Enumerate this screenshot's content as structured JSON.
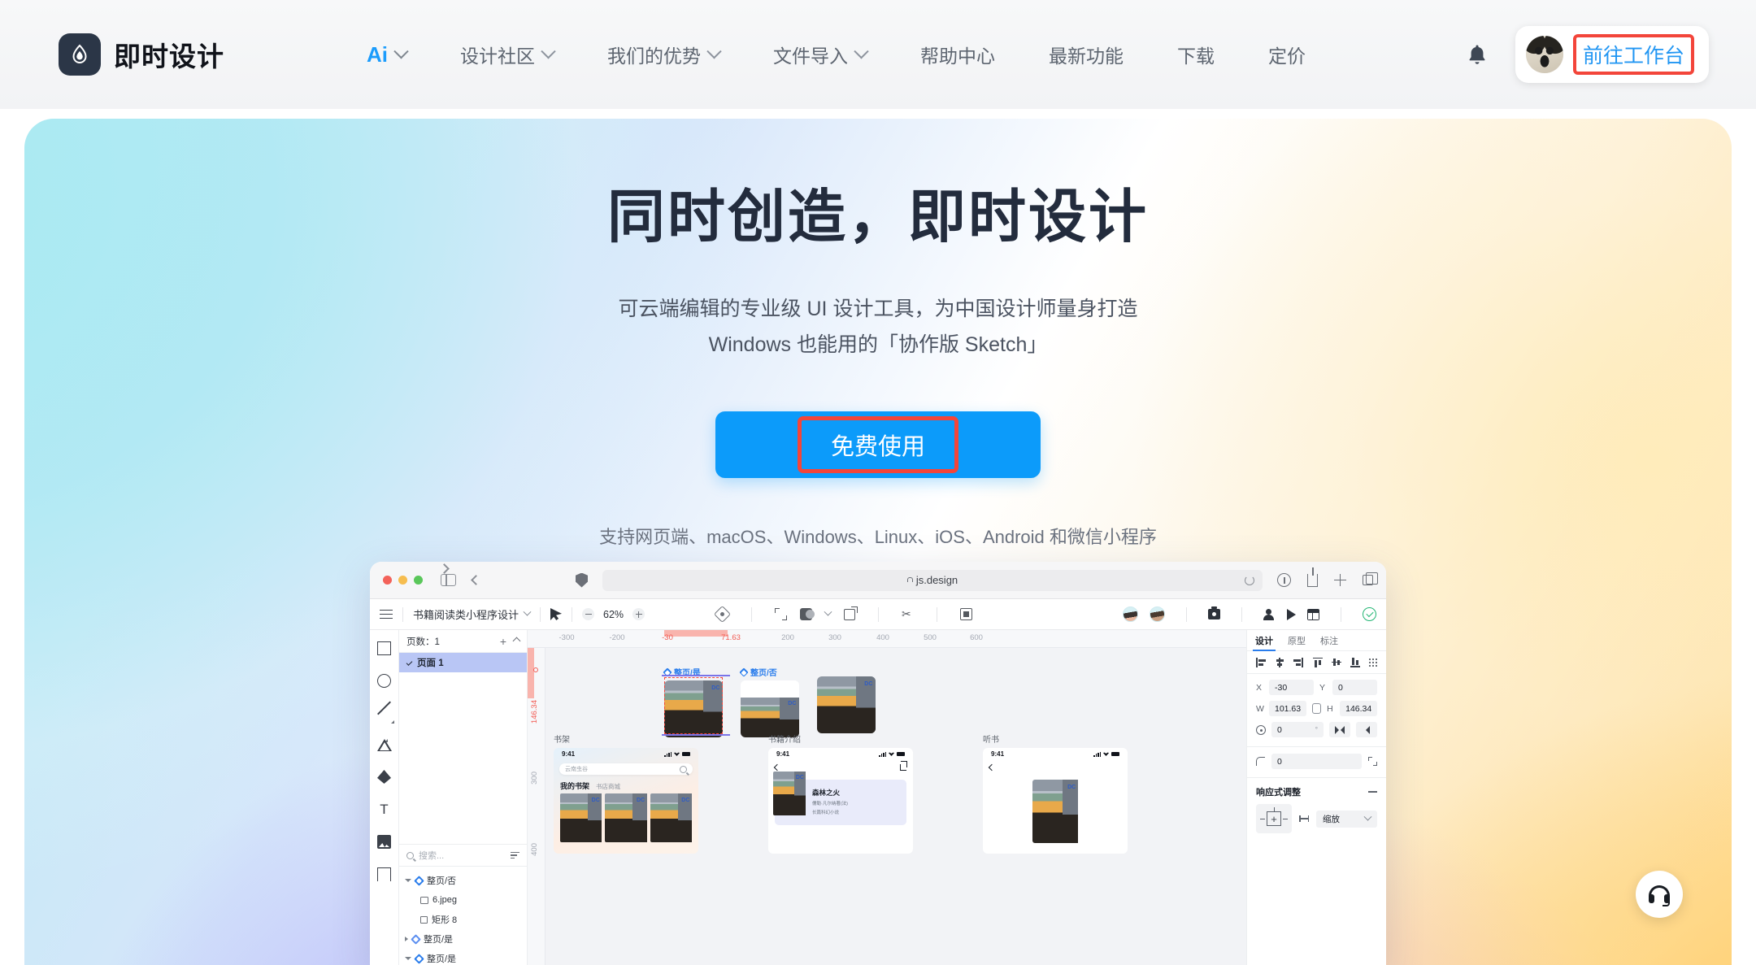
{
  "nav": {
    "brand": "即时设计",
    "logo_icon": "flame-drop-logo-icon",
    "items": [
      {
        "label": "Ai",
        "has_dropdown": true,
        "accent": true
      },
      {
        "label": "设计社区",
        "has_dropdown": true
      },
      {
        "label": "我们的优势",
        "has_dropdown": true
      },
      {
        "label": "文件导入",
        "has_dropdown": true
      },
      {
        "label": "帮助中心",
        "has_dropdown": false
      },
      {
        "label": "最新功能",
        "has_dropdown": false
      },
      {
        "label": "下载",
        "has_dropdown": false
      },
      {
        "label": "定价",
        "has_dropdown": false
      }
    ],
    "bell_icon": "notification-bell-icon",
    "avatar_icon": "user-avatar-dog",
    "workbench_label": "前往工作台"
  },
  "hero": {
    "title": "同时创造，即时设计",
    "subtitle_line1": "可云端编辑的专业级 UI 设计工具，为中国设计师量身打造",
    "subtitle_line2": "Windows 也能用的「协作版 Sketch」",
    "cta_label": "免费使用",
    "platforms": "支持网页端、macOS、Windows、Linux、iOS、Android 和微信小程序"
  },
  "colors": {
    "accent_blue": "#0c9bfa",
    "link_blue": "#2196f3",
    "highlight_red": "#f3453a",
    "hero_cyan": "#a8eaf2",
    "hero_violet": "#9a9af5",
    "hero_amber": "#ffc760",
    "brand_dark": "#2b3647"
  },
  "mockup": {
    "browser": {
      "url": "js.design",
      "lock_icon": "lock-icon",
      "shield_icon": "privacy-shield-icon",
      "sidebar_icon": "sidebar-toggle-icon",
      "back_icon": "back-arrow-icon",
      "forward_icon": "forward-arrow-icon",
      "reload_icon": "reload-icon",
      "downloads_icon": "downloads-icon",
      "share_icon": "share-icon",
      "newtab_icon": "new-tab-icon",
      "tabs_icon": "tab-overview-icon"
    },
    "app_toolbar": {
      "menu_icon": "hamburger-menu-icon",
      "doc_title": "书籍阅读类小程序设计",
      "cursor_icon": "cursor-tool-icon",
      "zoom_out_icon": "zoom-out-icon",
      "zoom_level": "62%",
      "zoom_in_icon": "zoom-in-icon",
      "component_icon": "component-icon",
      "frame_icon": "frame-tool-icon",
      "mask_icon": "mask-icon",
      "export_icon": "export-icon",
      "scissors_icon": "scissors-icon",
      "board_icon": "board-icon",
      "avatar_icons": [
        "collaborator-avatar-1",
        "collaborator-avatar-2"
      ],
      "camera_icon": "camera-icon",
      "invite_icon": "invite-member-icon",
      "play_icon": "present-play-icon",
      "layout_icon": "layout-icon",
      "status_icon": "saved-check-icon"
    },
    "tools": [
      "rectangle-tool-icon",
      "ellipse-tool-icon",
      "line-tool-icon",
      "polygon-tool-icon",
      "pen-tool-icon",
      "text-tool-icon",
      "image-tool-icon",
      "frame-tool-icon"
    ],
    "left_panel": {
      "pages_header": "页数：1",
      "add_icon": "add-page-icon",
      "collapse_icon": "collapse-icon",
      "page_name": "页面 1",
      "check_icon": "check-icon",
      "search_placeholder": "搜索...",
      "search_icon": "search-icon",
      "sort_icon": "sort-layers-icon",
      "layers": [
        {
          "name": "整页/否",
          "icon": "component-diamond-icon",
          "indent": 0,
          "expanded": true
        },
        {
          "name": "6.jpeg",
          "icon": "image-layer-icon",
          "indent": 1
        },
        {
          "name": "矩形 8",
          "icon": "rect-layer-icon",
          "indent": 1
        },
        {
          "name": "整页/是",
          "icon": "component-ring-icon",
          "indent": 0,
          "expanded": false
        },
        {
          "name": "整页/是",
          "icon": "component-diamond-icon",
          "indent": 0,
          "expanded": true
        }
      ]
    },
    "canvas": {
      "ruler_h": [
        "-300",
        "-200",
        "-30",
        "71.63",
        "200",
        "300",
        "400",
        "500",
        "600"
      ],
      "ruler_h_highlight": [
        "-30",
        "71.63"
      ],
      "ruler_v": [
        "146.34",
        "300",
        "400"
      ],
      "ruler_v_highlight": [
        "146.34"
      ],
      "boards": [
        {
          "label": "整页/是",
          "type": "component",
          "selected": true
        },
        {
          "label": "整页/否",
          "type": "component",
          "selected": false
        }
      ],
      "screens": [
        {
          "title": "书架",
          "time": "9:41",
          "search_value": "云南虫谷",
          "tab_on": "我的书架",
          "tab_off": "书店商城"
        },
        {
          "title": "书籍介绍",
          "time": "9:41",
          "book_title": "森林之火",
          "book_author": "儒勒·凡尔纳著(法)",
          "book_meta": "长篇科幻小说"
        },
        {
          "title": "听书",
          "time": "9:41"
        }
      ]
    },
    "right_panel": {
      "tabs": [
        {
          "label": "设计",
          "active": true
        },
        {
          "label": "原型",
          "active": false
        },
        {
          "label": "标注",
          "active": false
        }
      ],
      "align_icons": [
        "align-left-icon",
        "align-center-h-icon",
        "align-right-icon",
        "align-top-icon",
        "align-center-v-icon",
        "align-bottom-icon",
        "distribute-icon"
      ],
      "x_label": "X",
      "x_value": "-30",
      "y_label": "Y",
      "y_value": "0",
      "w_label": "W",
      "w_value": "101.63",
      "h_label": "H",
      "h_value": "146.34",
      "link_icon": "link-ratio-icon",
      "rotation_value": "0",
      "rotation_unit": "°",
      "flip_h_icon": "flip-horizontal-icon",
      "flip_v_icon": "flip-vertical-icon",
      "radius_value": "0",
      "radius_icon": "corner-radius-icon",
      "radius_expand_icon": "independent-corners-icon",
      "responsive_title": "响应式调整",
      "responsive_collapse_icon": "collapse-minus-icon",
      "constraint_icon": "constraint-pin-icon",
      "horizontal_icon": "horizontal-resize-icon",
      "horizontal_value": "缩放",
      "dropdown_icon": "chevron-down-icon"
    }
  },
  "support": {
    "icon": "headset-support-icon"
  }
}
